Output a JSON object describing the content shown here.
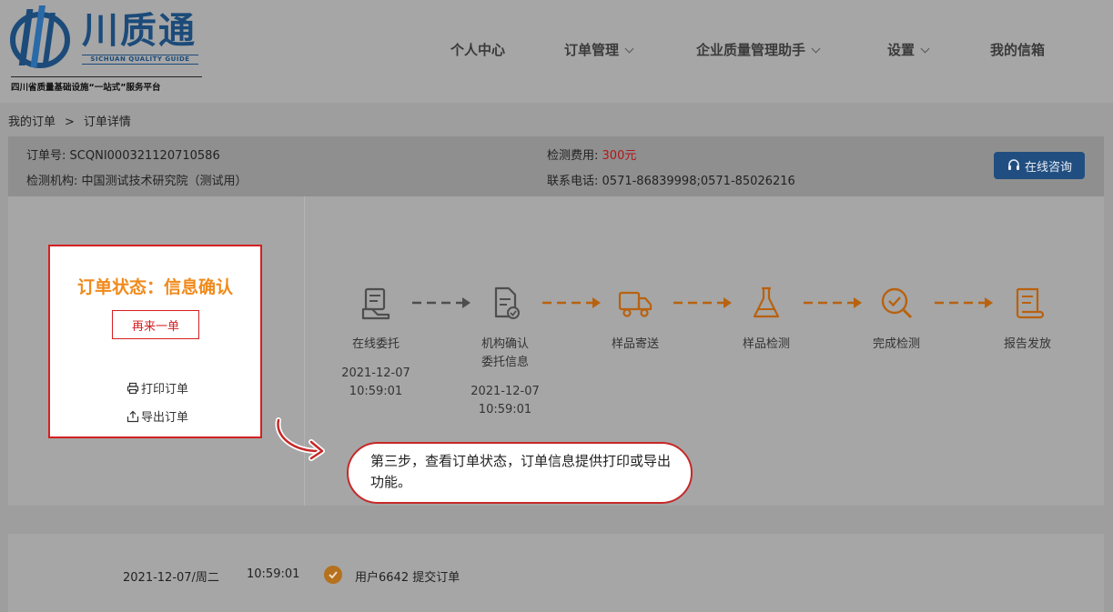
{
  "brand": {
    "name": "川质通",
    "english": "SICHUAN QUALITY GUIDE",
    "slogan": "四川省质量基础设施“一站式”服务平台"
  },
  "nav": {
    "personal": "个人中心",
    "orders": "订单管理",
    "assistant": "企业质量管理助手",
    "settings": "设置",
    "mailbox": "我的信箱"
  },
  "breadcrumb": {
    "parent": "我的订单",
    "separator": ">",
    "current": "订单详情"
  },
  "order": {
    "number_label": "订单号:",
    "number": "SCQNI000321120710586",
    "agency_label": "检测机构:",
    "agency": "中国测试技术研究院（测试用）",
    "fee_label": "检测费用:",
    "fee": "300元",
    "phone_label": "联系电话:",
    "phone": "0571-86839998;0571-85026216",
    "consult_label": "在线咨询"
  },
  "status": {
    "title": "订单状态：信息确认",
    "again_label": "再来一单",
    "print_label": "打印订单",
    "export_label": "导出订单"
  },
  "steps": [
    {
      "icon": "entrust-icon",
      "label1": "在线委托",
      "label2": "",
      "date": "2021-12-07",
      "time": "10:59:01"
    },
    {
      "icon": "confirm-document-icon",
      "label1": "机构确认",
      "label2": "委托信息",
      "date": "2021-12-07",
      "time": "10:59:01"
    },
    {
      "icon": "truck-icon",
      "label1": "样品寄送",
      "label2": "",
      "date": "",
      "time": ""
    },
    {
      "icon": "flask-icon",
      "label1": "样品检测",
      "label2": "",
      "date": "",
      "time": ""
    },
    {
      "icon": "magnifier-check-icon",
      "label1": "完成检测",
      "label2": "",
      "date": "",
      "time": ""
    },
    {
      "icon": "report-scroll-icon",
      "label1": "报告发放",
      "label2": "",
      "date": "",
      "time": ""
    }
  ],
  "callout": {
    "text": "第三步，查看订单状态，订单信息提供打印或导出功能。"
  },
  "history": {
    "date": "2021-12-07/周二",
    "time": "10:59:01",
    "event": "用户6642 提交订单"
  },
  "colors": {
    "done_step": "#4e4e4e",
    "pending_step": "#b8620f",
    "accent_orange": "#f08a1c",
    "alert_red": "#d42020",
    "brand_blue": "#1c4b7a"
  }
}
